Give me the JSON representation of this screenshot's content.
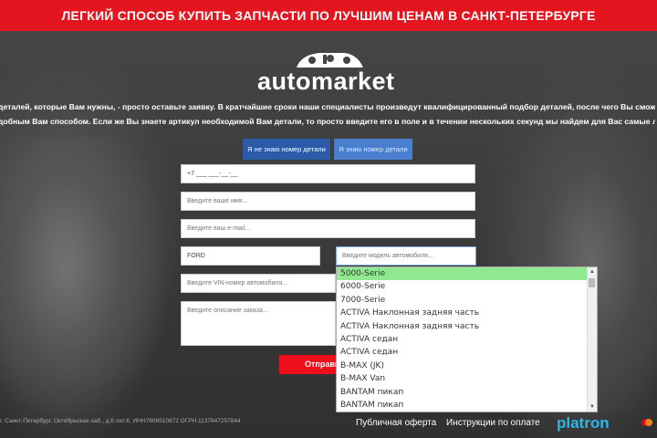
{
  "banner": {
    "text": "ЛЕГКИЙ СПОСОБ КУПИТЬ ЗАПЧАСТИ ПО ЛУЧШИМ ЦЕНАМ В САНКТ-ПЕТЕРБУРГЕ"
  },
  "logo": {
    "text": "automarket"
  },
  "description": {
    "line1": "деталей, которые Вам нужны, - просто оставьте заявку. В кратчайшие сроки наши специалисты произведут квалифицированный подбор деталей, после чего Вы сможете выбрать",
    "line2": "добным Вам способом. Если же Вы знаете артикул необходимой Вам детали, то просто введите его в поле и в течении нескольких секунд мы найдем для Вас самые лучшие предл"
  },
  "tabs": [
    {
      "label": "Я не знаю номер детали"
    },
    {
      "label": "Я знаю номер детали"
    }
  ],
  "form": {
    "phone_value": "+7 ___ ___-__-__",
    "name_placeholder": "Введите ваше имя...",
    "email_placeholder": "Введите ваш e-mail...",
    "brand_value": "FORD",
    "model_placeholder": "Введите модель автомобиля...",
    "vin_placeholder": "Введите VIN-номер автомобиля...",
    "desc_placeholder": "Введите описание заказа...",
    "submit_label": "Отправить"
  },
  "dropdown": {
    "options": [
      "5000-Serie",
      "6000-Serie",
      "7000-Serie",
      "ACTIVA Наклонная задняя часть",
      "ACTIVA Наклонная задняя часть",
      "ACTIVA седан",
      "ACTIVA седан",
      "B-MAX (JK)",
      "B-MAX Van",
      "BANTAM пикап",
      "BANTAM пикап"
    ],
    "selected_index": 0
  },
  "footer": {
    "address": "г. Санкт-Петербург, Октябрьская наб., д.6 лит.К, ИНН7806510872 ОГРН 1137847257844",
    "link1": "Публичная оферта",
    "link2": "Инструкции по оплате",
    "platron": "platron"
  },
  "colors": {
    "banner": "#e4151f",
    "tab_active": "#2b5aa6",
    "tab_inactive": "#4a7fd0",
    "selected_option": "#90e890",
    "submit": "#ef0e1c",
    "platron": "#2db7e8"
  }
}
